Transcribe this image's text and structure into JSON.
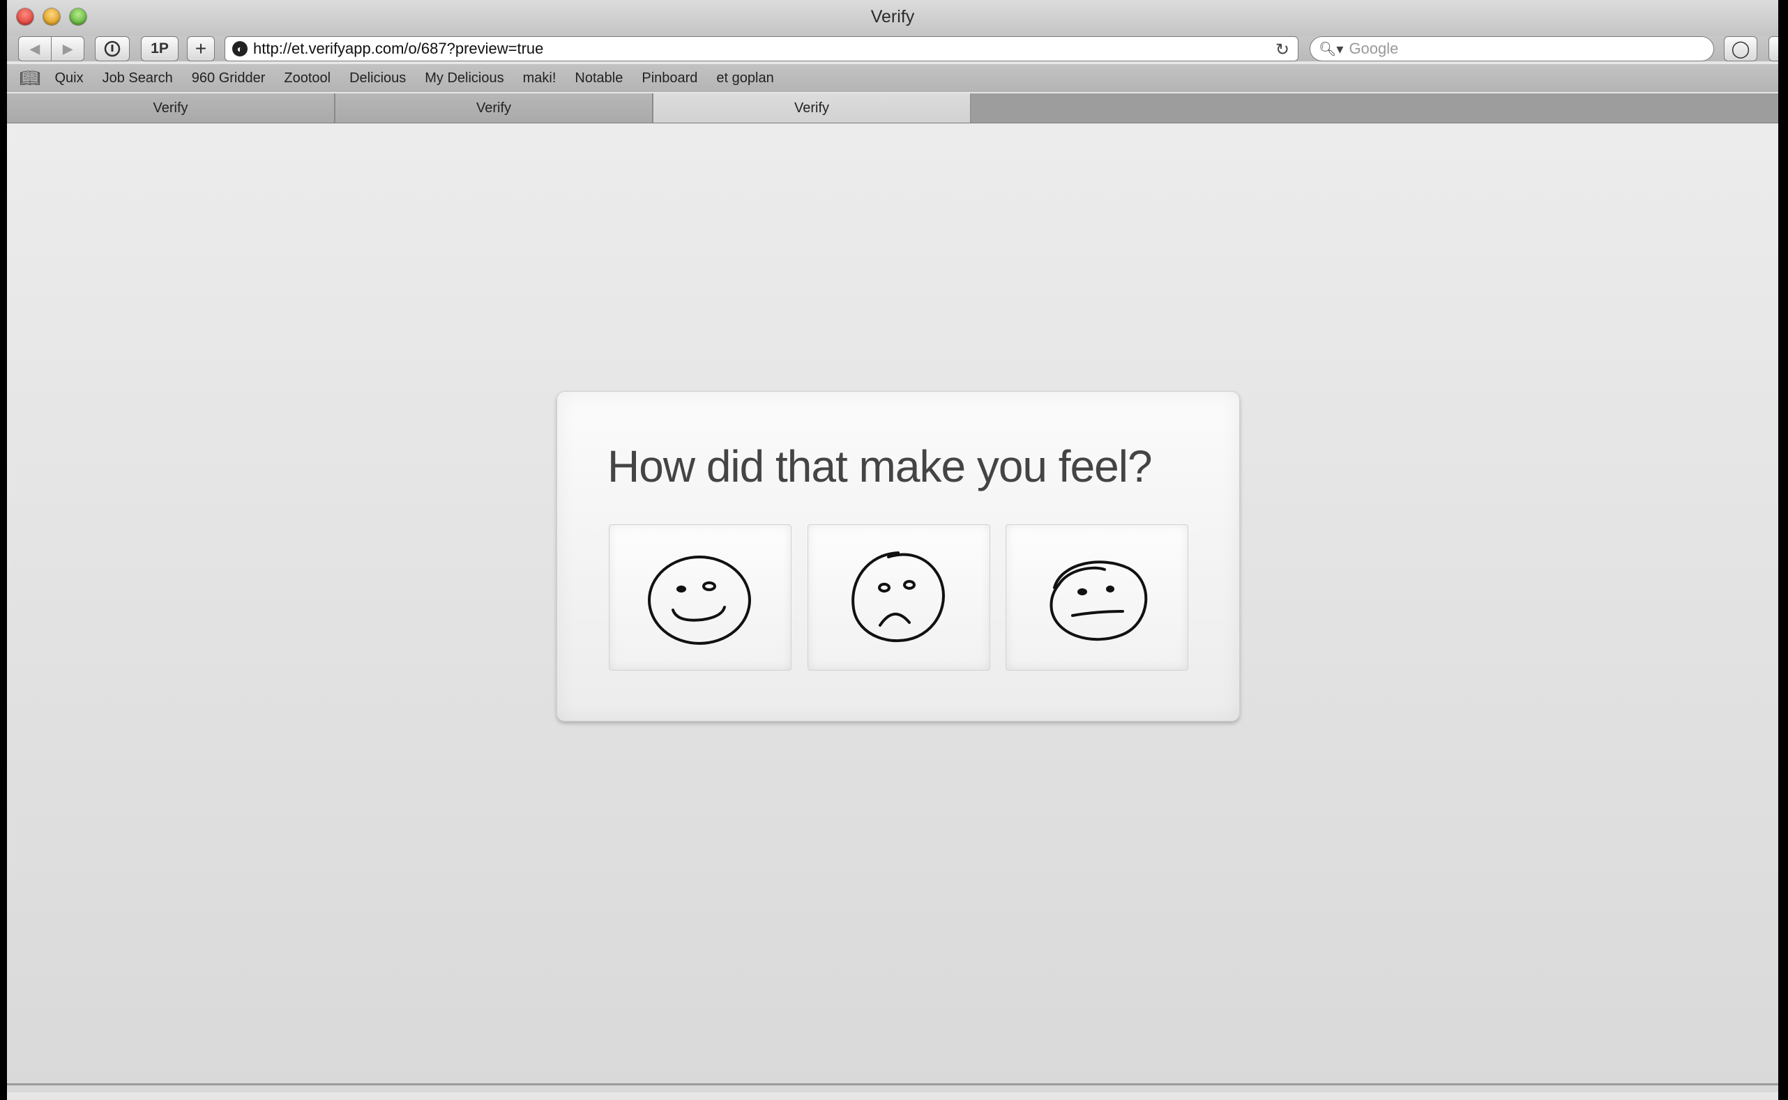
{
  "window": {
    "title": "Verify"
  },
  "toolbar": {
    "back_icon": "back-arrow-icon",
    "forward_icon": "forward-arrow-icon",
    "onepassword_label": "1P",
    "add_label": "+",
    "url": "http://et.verifyapp.com/o/687?preview=true",
    "search_placeholder": "Google"
  },
  "bookmarks": [
    {
      "label": "Quix"
    },
    {
      "label": "Job Search"
    },
    {
      "label": "960 Gridder"
    },
    {
      "label": "Zootool"
    },
    {
      "label": "Delicious"
    },
    {
      "label": "My Delicious"
    },
    {
      "label": "maki!"
    },
    {
      "label": "Notable"
    },
    {
      "label": "Pinboard"
    },
    {
      "label": "et goplan"
    }
  ],
  "tabs": [
    {
      "label": "Verify",
      "active": false
    },
    {
      "label": "Verify",
      "active": false
    },
    {
      "label": "Verify",
      "active": true
    }
  ],
  "main": {
    "question": "How did that make you feel?",
    "options": [
      {
        "icon": "happy-face-icon"
      },
      {
        "icon": "sad-face-icon"
      },
      {
        "icon": "neutral-face-icon"
      }
    ]
  }
}
